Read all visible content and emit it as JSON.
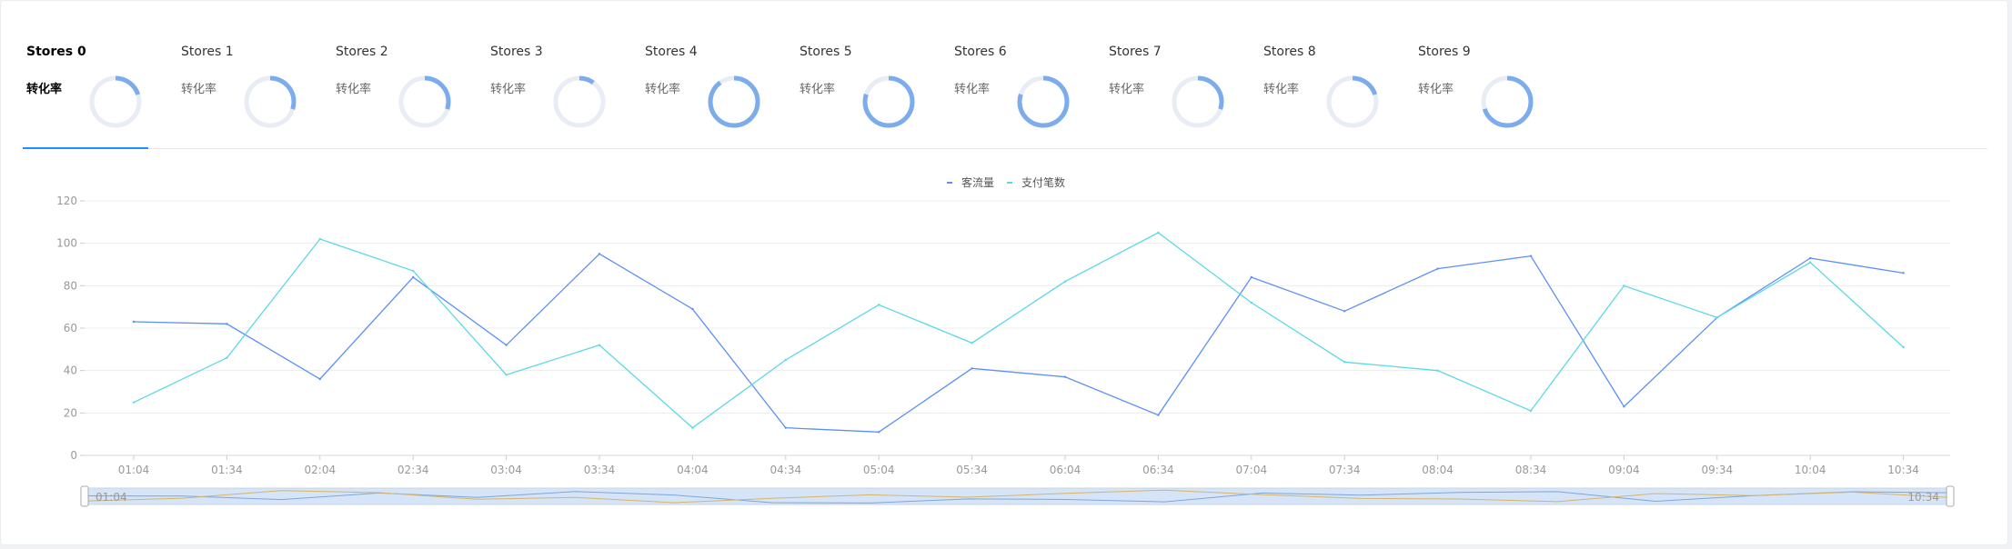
{
  "tabs": [
    {
      "name": "Stores 0",
      "rate_label": "转化率",
      "rate": 0.2,
      "active": true
    },
    {
      "name": "Stores 1",
      "rate_label": "转化率",
      "rate": 0.3
    },
    {
      "name": "Stores 2",
      "rate_label": "转化率",
      "rate": 0.3
    },
    {
      "name": "Stores 3",
      "rate_label": "转化率",
      "rate": 0.1
    },
    {
      "name": "Stores 4",
      "rate_label": "转化率",
      "rate": 0.9
    },
    {
      "name": "Stores 5",
      "rate_label": "转化率",
      "rate": 0.8
    },
    {
      "name": "Stores 6",
      "rate_label": "转化率",
      "rate": 0.8
    },
    {
      "name": "Stores 7",
      "rate_label": "转化率",
      "rate": 0.3
    },
    {
      "name": "Stores 8",
      "rate_label": "转化率",
      "rate": 0.2
    },
    {
      "name": "Stores 9",
      "rate_label": "转化率",
      "rate": 0.7
    }
  ],
  "colors": {
    "accent": "#1890ff",
    "ring_track": "#e8edf5",
    "ring_fill": "#7cacec",
    "series_1": "#5b8ff9",
    "series_2": "#5ad8e6",
    "slider_fill": "#d6e4f7",
    "slider_line_1": "#7ea6d8",
    "slider_line_2": "#d6b468"
  },
  "chart_data": {
    "type": "line",
    "x": [
      "01:04",
      "01:34",
      "02:04",
      "02:34",
      "03:04",
      "03:34",
      "04:04",
      "04:34",
      "05:04",
      "05:34",
      "06:04",
      "06:34",
      "07:04",
      "07:34",
      "08:04",
      "08:34",
      "09:04",
      "09:34",
      "10:04",
      "10:34"
    ],
    "series": [
      {
        "name": "客流量",
        "values": [
          63,
          62,
          36,
          84,
          52,
          95,
          69,
          13,
          11,
          41,
          37,
          19,
          84,
          68,
          88,
          94,
          23,
          65,
          93,
          86
        ]
      },
      {
        "name": "支付笔数",
        "values": [
          25,
          46,
          102,
          87,
          38,
          52,
          13,
          45,
          71,
          53,
          82,
          105,
          72,
          44,
          40,
          21,
          80,
          65,
          91,
          51
        ]
      }
    ],
    "yticks": [
      0,
      20,
      40,
      60,
      80,
      100,
      120
    ],
    "ylim": [
      0,
      120
    ],
    "grid": true,
    "legend": "top-center",
    "slider": {
      "start_label": "01:04",
      "end_label": "10:34"
    }
  }
}
